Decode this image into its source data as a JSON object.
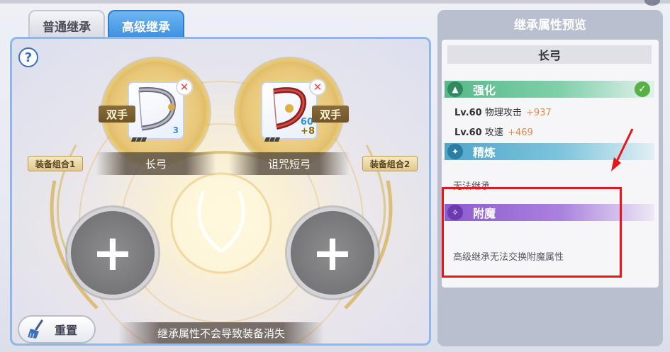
{
  "tabs": [
    {
      "label": "普通继承",
      "active": false
    },
    {
      "label": "高级继承",
      "active": true
    }
  ],
  "main": {
    "help_label": "?",
    "slots": [
      {
        "item_name": "长弓",
        "hand_tag": "双手",
        "count": "3",
        "combo_tag": "装备组合1",
        "stars": 3
      },
      {
        "item_name": "诅咒短弓",
        "hand_tag": "双手",
        "refine_level": "60",
        "enhance_level": "+8",
        "combo_tag": "装备组合2",
        "stars": 3
      }
    ],
    "add_label": "+",
    "close_label": "✕",
    "reset_label": "重置",
    "footer_note": "继承属性不会导致装备消失"
  },
  "preview": {
    "header": "继承属性预览",
    "item_name": "长弓",
    "sections": {
      "enhance": {
        "label": "强化",
        "check": "✓",
        "stats": [
          {
            "level": "Lv.60",
            "stat": "物理攻击",
            "bonus": "+937"
          },
          {
            "level": "Lv.60",
            "stat": "攻速",
            "bonus": "+469"
          }
        ]
      },
      "refine": {
        "label": "精炼",
        "text": "无法继承"
      },
      "enchant": {
        "label": "附魔",
        "text": "高级继承无法交换附魔属性"
      }
    }
  },
  "colors": {
    "tab_active": "#3b8ee0",
    "enhance": "#56b98c",
    "refine": "#4fa6c8",
    "enchant": "#8d5ad0",
    "bonus": "#e38a4a",
    "highlight": "#e8161b"
  }
}
